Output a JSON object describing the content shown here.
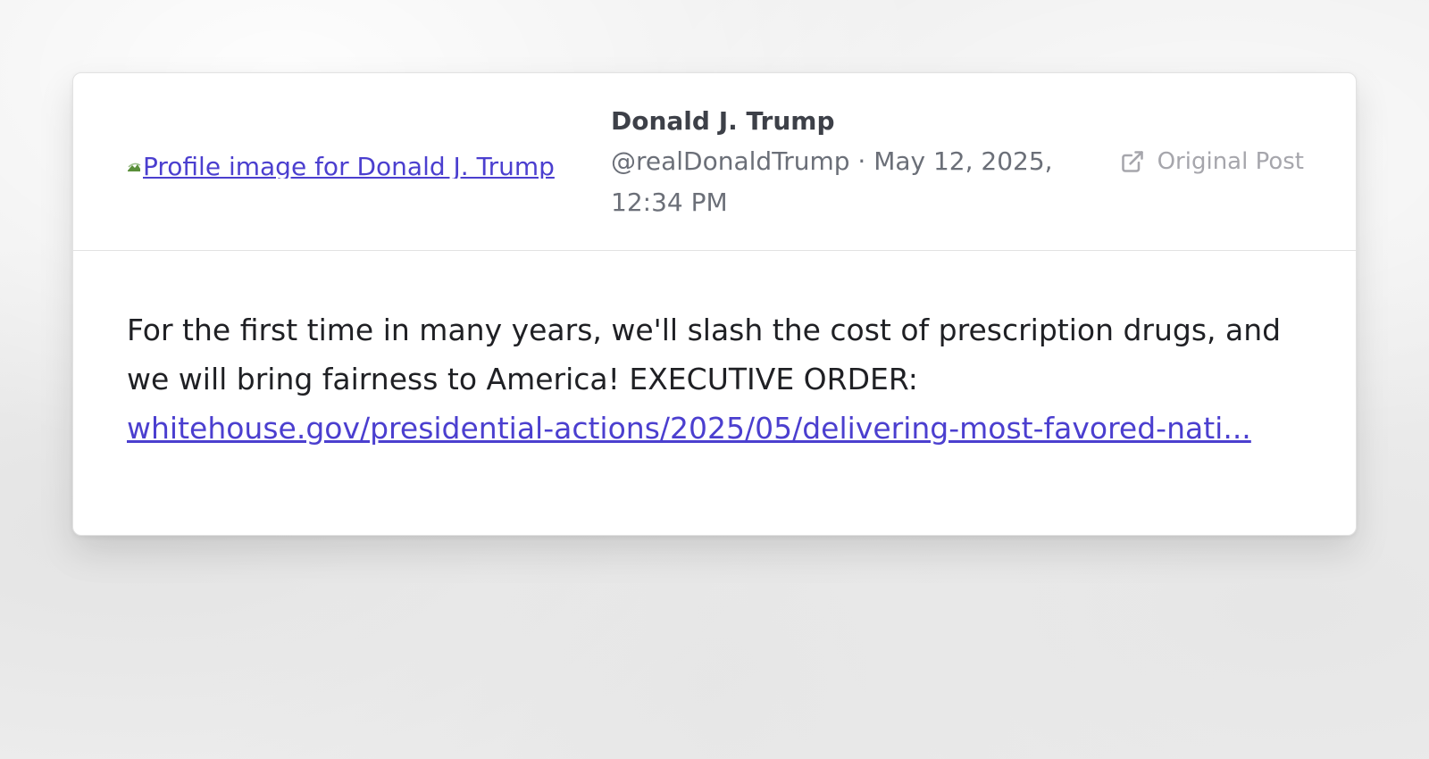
{
  "post": {
    "avatar_alt": "Profile image for Donald J. Trump",
    "author_name": "Donald J. Trump",
    "author_handle_date": "@realDonaldTrump · May 12, 2025, 12:34 PM",
    "original_post_label": "Original Post",
    "body_text": "For the first time in many years, we'll slash the cost of prescription drugs, and we will bring fairness to America! EXECUTIVE ORDER:",
    "link_text": "whitehouse.gov/presidential-actions/2025/05/delivering-most-favored-nati..."
  },
  "icons": {
    "broken_image": "broken-image-icon",
    "external_link": "external-link-icon"
  },
  "colors": {
    "link": "#4b3fcf",
    "muted": "#a6a6ac",
    "text": "#1f2024"
  }
}
